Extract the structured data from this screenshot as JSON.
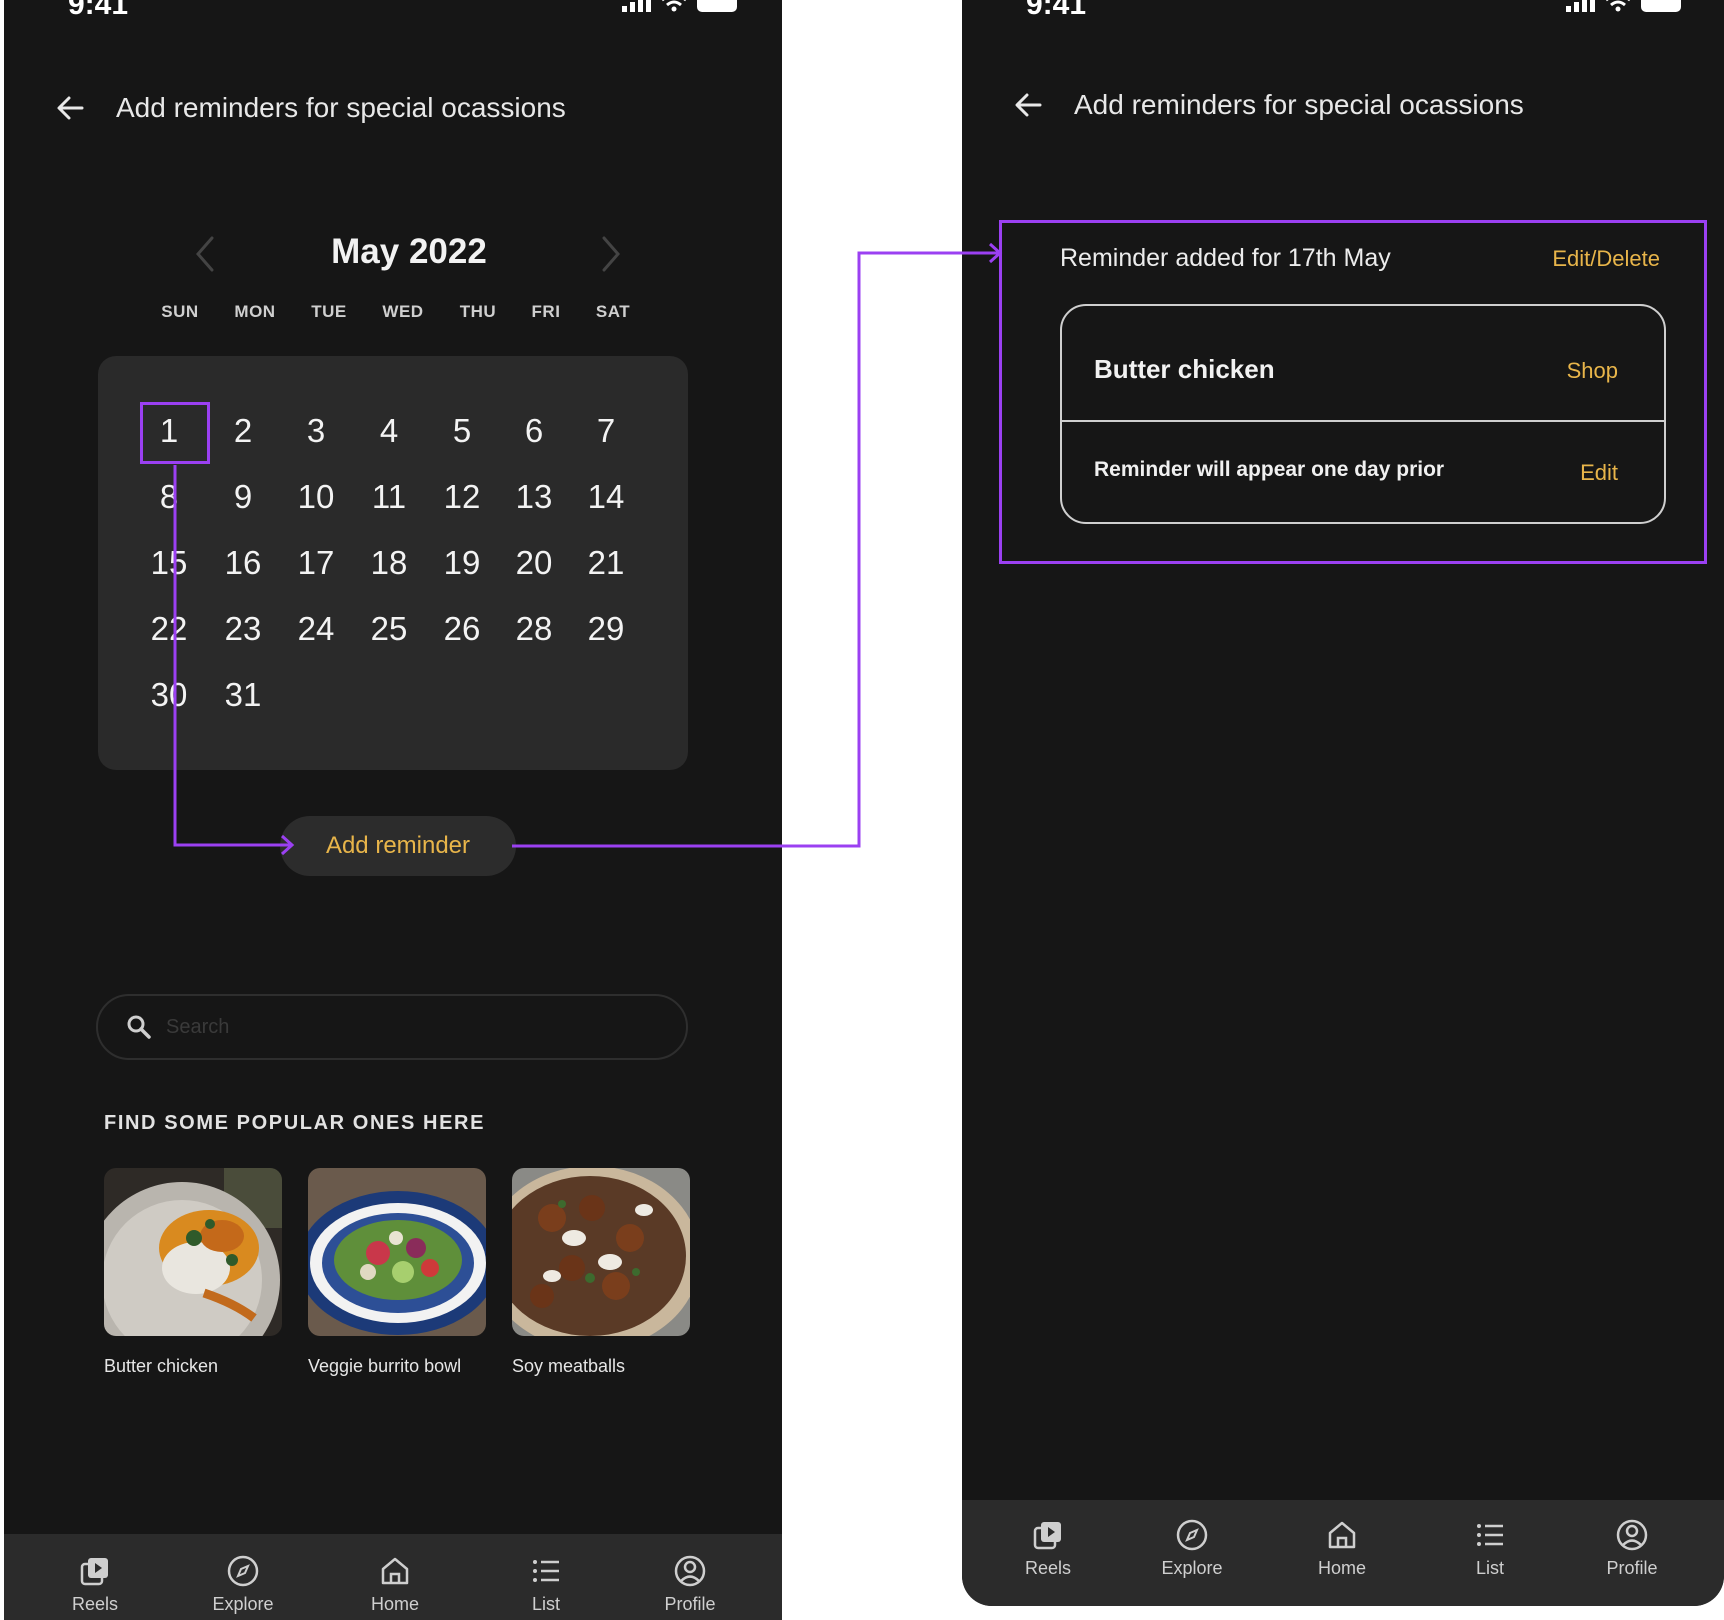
{
  "colors": {
    "background": "#161616",
    "accent": "#e8b54a",
    "annotation": "#9b40f2",
    "panel": "#2a2a2a"
  },
  "status_bar": {
    "time": "9:41"
  },
  "calendar_screen": {
    "header": {
      "back_icon": "arrow-left-icon",
      "title": "Add reminders for special ocassions"
    },
    "calendar": {
      "month_label": "May 2022",
      "weekdays": [
        "SUN",
        "MON",
        "TUE",
        "WED",
        "THU",
        "FRI",
        "SAT"
      ],
      "weeks": [
        [
          "1",
          "2",
          "3",
          "4",
          "5",
          "6",
          "7"
        ],
        [
          "8",
          "9",
          "10",
          "11",
          "12",
          "13",
          "14"
        ],
        [
          "15",
          "16",
          "17",
          "18",
          "19",
          "20",
          "21"
        ],
        [
          "22",
          "23",
          "24",
          "25",
          "26",
          "28",
          "29"
        ],
        [
          "30",
          "31"
        ]
      ],
      "selected_day": "1"
    },
    "add_reminder_label": "Add reminder",
    "search": {
      "placeholder": "Search"
    },
    "popular": {
      "heading": "FIND SOME POPULAR ONES HERE",
      "items": [
        {
          "label": "Butter chicken"
        },
        {
          "label": "Veggie burrito bowl"
        },
        {
          "label": "Soy meatballs"
        }
      ]
    }
  },
  "reminder_screen": {
    "header": {
      "back_icon": "arrow-left-icon",
      "title": "Add reminders for special ocassions"
    },
    "reminder": {
      "title": "Reminder added for 17th May",
      "edit_delete_label": "Edit/Delete",
      "dish": "Butter chicken",
      "shop_label": "Shop",
      "note": "Reminder will appear one day prior",
      "edit_label": "Edit"
    }
  },
  "bottom_nav": [
    {
      "label": "Reels",
      "icon": "reels-icon"
    },
    {
      "label": "Explore",
      "icon": "compass-icon"
    },
    {
      "label": "Home",
      "icon": "home-icon"
    },
    {
      "label": "List",
      "icon": "list-icon"
    },
    {
      "label": "Profile",
      "icon": "profile-icon"
    }
  ]
}
